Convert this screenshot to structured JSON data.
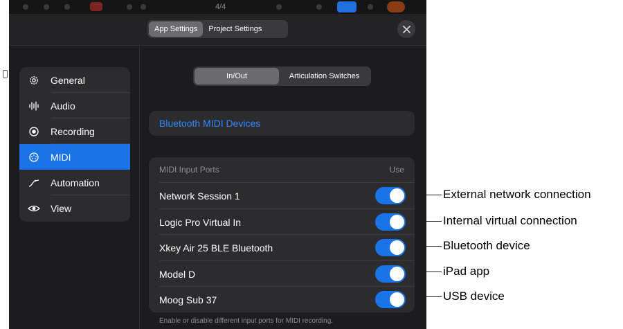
{
  "status_strip": {
    "text": "4/4"
  },
  "header": {
    "tabs": [
      {
        "label": "App Settings",
        "active": true
      },
      {
        "label": "Project Settings",
        "active": false
      }
    ],
    "close_icon": "close-icon"
  },
  "sidebar": {
    "items": [
      {
        "label": "General",
        "icon": "gear-icon",
        "active": false
      },
      {
        "label": "Audio",
        "icon": "waveform-icon",
        "active": false
      },
      {
        "label": "Recording",
        "icon": "record-icon",
        "active": false
      },
      {
        "label": "MIDI",
        "icon": "midi-port-icon",
        "active": true
      },
      {
        "label": "Automation",
        "icon": "automation-curve-icon",
        "active": false
      },
      {
        "label": "View",
        "icon": "eye-icon",
        "active": false
      }
    ]
  },
  "subtabs": [
    {
      "label": "In/Out",
      "active": true
    },
    {
      "label": "Articulation Switches",
      "active": false
    }
  ],
  "bluetooth": {
    "label": "Bluetooth MIDI Devices"
  },
  "midi_inputs": {
    "header": "MIDI Input Ports",
    "use_label": "Use",
    "ports": [
      {
        "name": "Network Session 1",
        "enabled": true
      },
      {
        "name": "Logic Pro Virtual In",
        "enabled": true
      },
      {
        "name": "Xkey Air 25 BLE Bluetooth",
        "enabled": true
      },
      {
        "name": "Model D",
        "enabled": true
      },
      {
        "name": "Moog Sub 37",
        "enabled": true
      }
    ],
    "footnote": "Enable or disable different input ports for MIDI recording."
  },
  "callouts": [
    "External network connection",
    "Internal virtual connection",
    "Bluetooth device",
    "iPad app",
    "USB device"
  ],
  "colors": {
    "accent": "#1a74e8",
    "link": "#2f88ff",
    "panel_bg": "#1c1c1e",
    "card_bg": "#2c2c2e"
  }
}
